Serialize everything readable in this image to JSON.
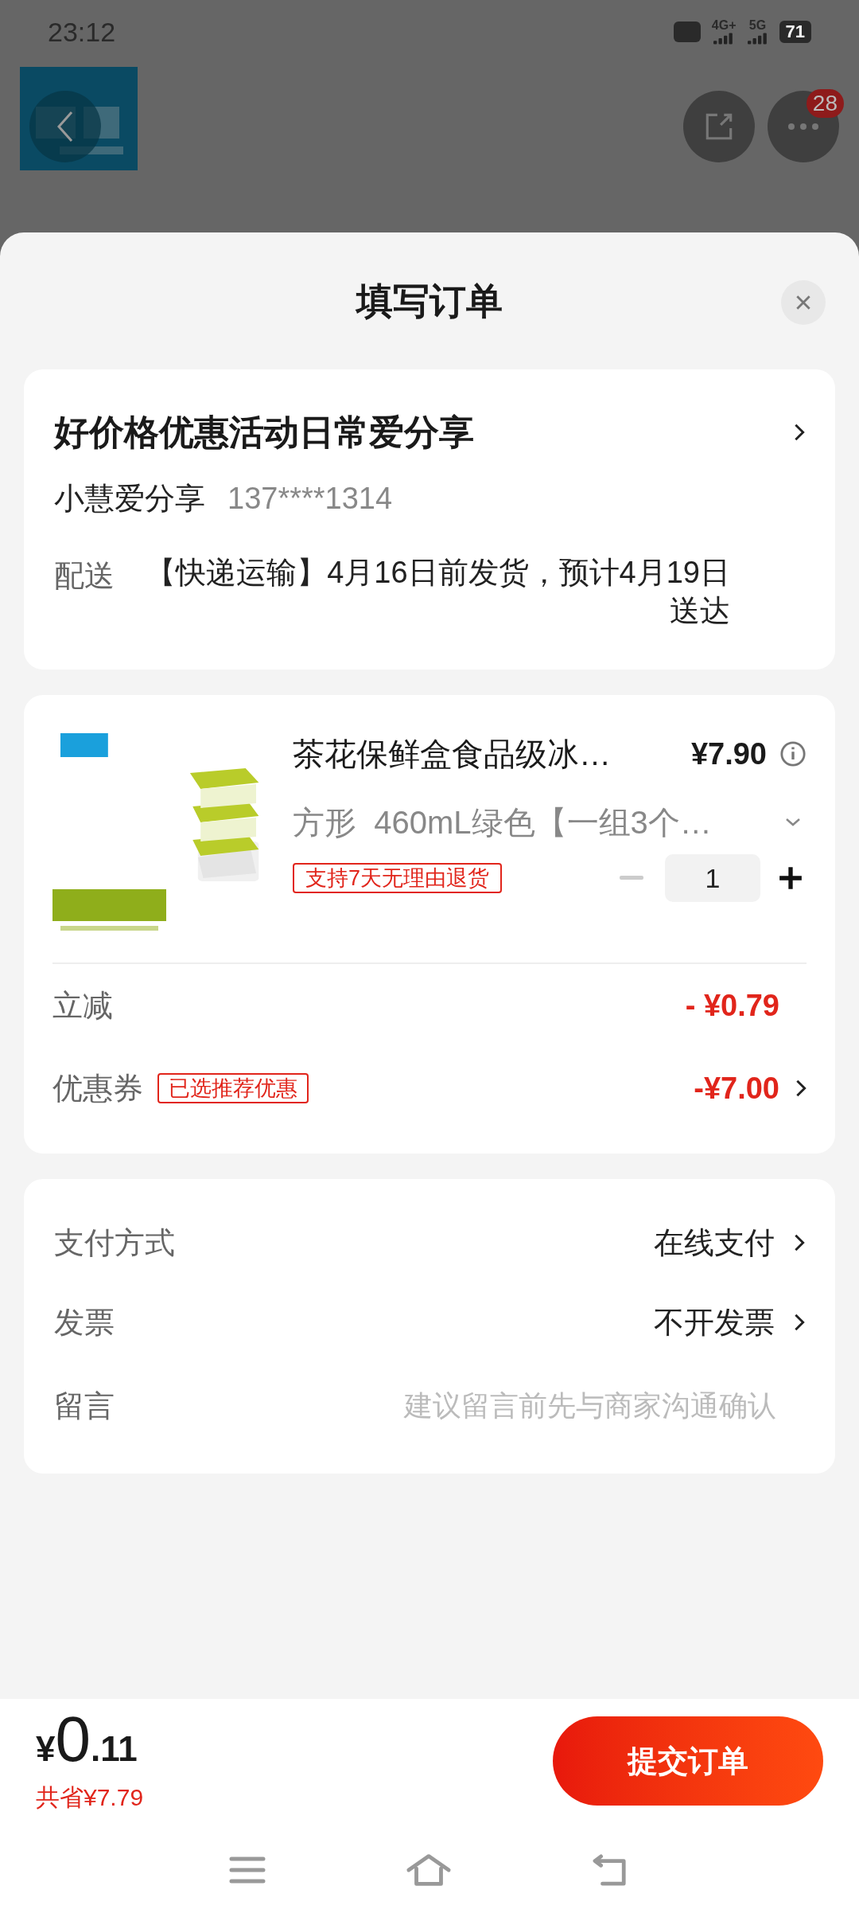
{
  "status_bar": {
    "time": "23:12",
    "network_1": "4G+",
    "network_2": "5G",
    "battery": "71"
  },
  "top_bar": {
    "badge": "28"
  },
  "sheet": {
    "title": "填写订单"
  },
  "address": {
    "title": "好价格优惠活动日常爱分享",
    "name": "小慧爱分享",
    "phone": "137****1314",
    "delivery_label": "配送",
    "delivery_text": "【快递运输】4月16日前发货，预计4月19日送达"
  },
  "product": {
    "title": "茶花保鲜盒食品级冰…",
    "price": "¥7.90",
    "spec": "方形  460mL绿色【一组3个…",
    "tag": "支持7天无理由退货",
    "quantity": "1"
  },
  "discounts": [
    {
      "label": "立减",
      "value": "- ¥0.79",
      "chevron": false
    },
    {
      "label": "优惠券",
      "tag": "已选推荐优惠",
      "value": "-¥7.00",
      "chevron": true
    }
  ],
  "options": [
    {
      "label": "支付方式",
      "value": "在线支付",
      "kind": "link"
    },
    {
      "label": "发票",
      "value": "不开发票",
      "kind": "link"
    },
    {
      "label": "留言",
      "placeholder": "建议留言前先与商家沟通确认",
      "kind": "input"
    }
  ],
  "footer": {
    "currency": "¥",
    "price_int": "0",
    "price_dec": ".11",
    "saved": "共省¥7.79",
    "submit": "提交订单"
  }
}
